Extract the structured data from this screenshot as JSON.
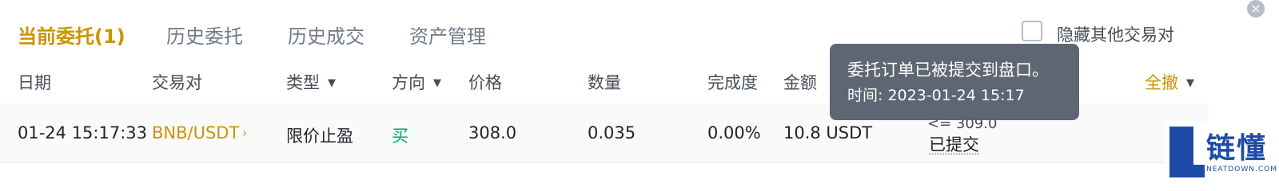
{
  "tabs": [
    {
      "label": "当前委托(1)",
      "active": true
    },
    {
      "label": "历史委托"
    },
    {
      "label": "历史成交"
    },
    {
      "label": "资产管理"
    }
  ],
  "hide_other_pairs": {
    "label": "隐藏其他交易对",
    "checked": false
  },
  "close_icon": "×",
  "columns": {
    "date": "日期",
    "pair": "交易对",
    "type": "类型",
    "side": "方向",
    "price": "价格",
    "amount": "数量",
    "filled": "完成度",
    "total": "金额",
    "cancel_all": "全撤"
  },
  "order": {
    "date": "01-24 15:17:33",
    "pair": "BNB/USDT",
    "pair_chevron": "›",
    "type": "限价止盈",
    "side": "买",
    "price": "308.0",
    "amount": "0.035",
    "filled": "0.00%",
    "total": "10.8 USDT",
    "trigger_partial": "<= 309.0",
    "status": "已提交"
  },
  "tooltip": {
    "message": "委托订单已被提交到盘口。",
    "time": "时间: 2023-01-24 15:17"
  },
  "watermark": {
    "brand": "链懂",
    "site": "NEATDOWN.COM"
  },
  "colors": {
    "accent": "#c99400",
    "buy": "#03a66d",
    "tooltip_bg": "#5e6673"
  }
}
